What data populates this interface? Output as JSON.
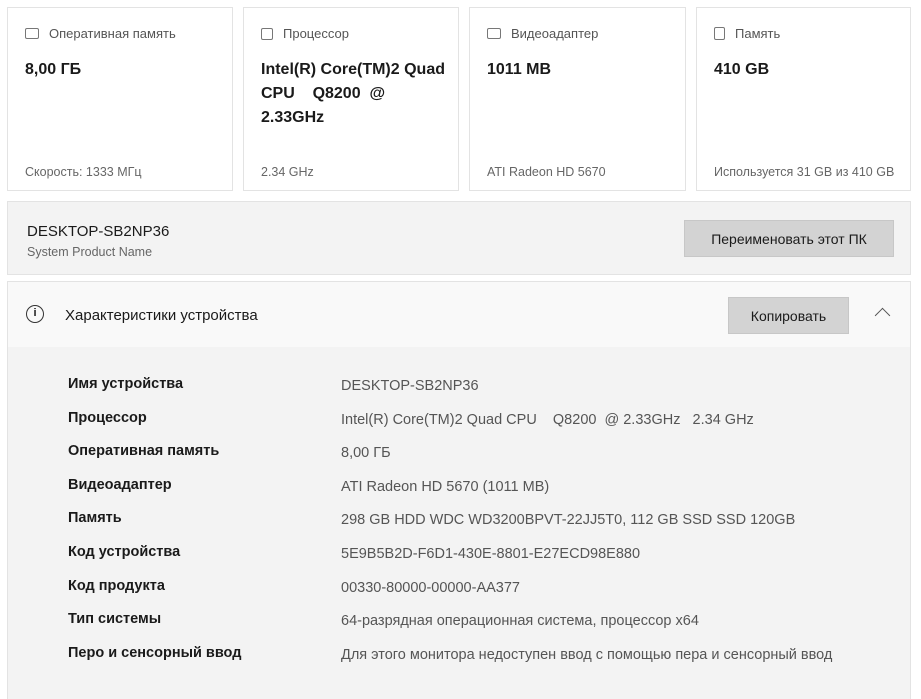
{
  "cards": [
    {
      "icon": "ram-icon",
      "title": "Оперативная память",
      "value": "8,00 ГБ",
      "sub": "Скорость: 1333 МГц"
    },
    {
      "icon": "cpu-icon",
      "title": "Процессор",
      "value": "Intel(R) Core(TM)2 Quad CPU    Q8200  @ 2.33GHz",
      "sub": "2.34 GHz"
    },
    {
      "icon": "gpu-icon",
      "title": "Видеоадаптер",
      "value": "1011 MB",
      "sub": "ATI Radeon HD 5670"
    },
    {
      "icon": "storage-icon",
      "title": "Память",
      "value": "410 GB",
      "sub": "Используется 31 GB из 410 GB"
    }
  ],
  "device": {
    "name": "DESKTOP-SB2NP36",
    "model": "System Product Name",
    "rename_label": "Переименовать этот ПК"
  },
  "specs": {
    "title": "Характеристики устройства",
    "copy_label": "Копировать",
    "rows": [
      {
        "k": "Имя устройства",
        "v": "DESKTOP-SB2NP36"
      },
      {
        "k": "Процессор",
        "v": "Intel(R) Core(TM)2 Quad CPU    Q8200  @ 2.33GHz   2.34 GHz"
      },
      {
        "k": "Оперативная память",
        "v": "8,00 ГБ"
      },
      {
        "k": "Видеоадаптер",
        "v": "ATI Radeon HD 5670 (1011 MB)"
      },
      {
        "k": "Память",
        "v": "298 GB HDD WDC WD3200BPVT-22JJ5T0, 112 GB SSD SSD 120GB"
      },
      {
        "k": "Код устройства",
        "v": "5E9B5B2D-F6D1-430E-8801-E27ECD98E880"
      },
      {
        "k": "Код продукта",
        "v": "00330-80000-00000-AA377"
      },
      {
        "k": "Тип системы",
        "v": "64-разрядная операционная система, процессор x64"
      },
      {
        "k": "Перо и сенсорный ввод",
        "v": "Для этого монитора недоступен ввод с помощью пера и сенсорный ввод"
      }
    ]
  }
}
